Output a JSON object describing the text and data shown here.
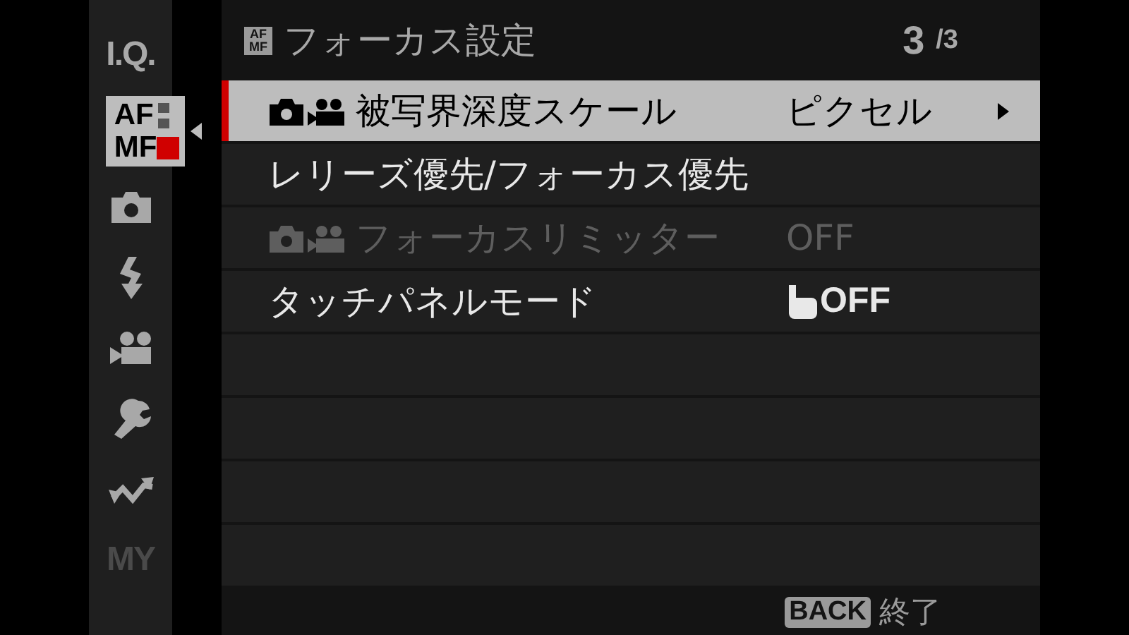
{
  "sidebar": {
    "items": [
      {
        "kind": "text",
        "label": "I.Q.",
        "selected": false,
        "disabled": false
      },
      {
        "kind": "afmf",
        "top": "AF",
        "bottom": "MF",
        "selected": true,
        "disabled": false
      },
      {
        "kind": "camera",
        "selected": false,
        "disabled": false
      },
      {
        "kind": "flash",
        "selected": false,
        "disabled": false
      },
      {
        "kind": "movie",
        "selected": false,
        "disabled": false
      },
      {
        "kind": "wrench",
        "selected": false,
        "disabled": false
      },
      {
        "kind": "wave",
        "selected": false,
        "disabled": false
      },
      {
        "kind": "text",
        "label": "MY",
        "selected": false,
        "disabled": true
      }
    ]
  },
  "header": {
    "icon_top": "AF",
    "icon_bottom": "MF",
    "title": "フォーカス設定",
    "page": "3",
    "page_total": "/3"
  },
  "rows": [
    {
      "label": "被写界深度スケール",
      "value": "ピクセル",
      "still_movie_icon": true,
      "touch_icon": false,
      "selected": true,
      "disabled": false
    },
    {
      "label": "レリーズ優先/フォーカス優先",
      "still_movie_icon": false,
      "touch_icon": false,
      "selected": false,
      "disabled": false
    },
    {
      "label": "フォーカスリミッター",
      "value": "OFF",
      "still_movie_icon": true,
      "touch_icon": false,
      "selected": false,
      "disabled": true
    },
    {
      "label": "タッチパネルモード",
      "value": "OFF",
      "still_movie_icon": false,
      "touch_icon": true,
      "selected": false,
      "disabled": false
    }
  ],
  "footer": {
    "key": "BACK",
    "action": "終了"
  }
}
